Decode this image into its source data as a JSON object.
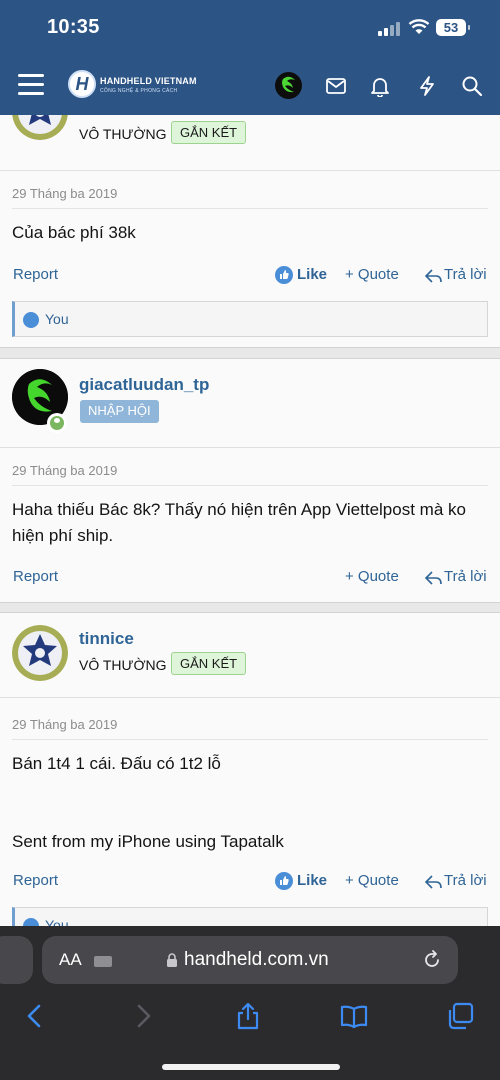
{
  "status": {
    "time": "10:35",
    "battery": "53"
  },
  "site": {
    "name": "HANDHELD VIETNAM",
    "tagline": "CÔNG NGHỆ & PHONG CÁCH",
    "mark": "H"
  },
  "posts": [
    {
      "rank": "VÔ THƯỜNG",
      "badge": "GẮN KẾT",
      "date": "29 Tháng ba 2019",
      "body": "Của bác phí 38k",
      "report": "Report",
      "like": "Like",
      "quote": "+ Quote",
      "reply": "Trả lời",
      "likes_by": "You"
    },
    {
      "username": "giacatluudan_tp",
      "badge": "NHẬP HỘI",
      "date": "29 Tháng ba 2019",
      "body": "Haha thiếu Bác 8k? Thấy nó hiện trên App Viettelpost mà ko hiện phí ship.",
      "report": "Report",
      "quote": "+ Quote",
      "reply": "Trả lời"
    },
    {
      "username": "tinnice",
      "rank": "VÔ THƯỜNG",
      "badge": "GẮN KẾT",
      "date": "29 Tháng ba 2019",
      "body_line1": "Bán 1t4 1 cái. Đấu có 1t2 lỗ",
      "body_line2": "Sent from my iPhone using Tapatalk",
      "report": "Report",
      "like": "Like",
      "quote": "+ Quote",
      "reply": "Trả lời",
      "likes_by": "You"
    }
  ],
  "browser": {
    "aa": "AA",
    "url": "handheld.com.vn"
  },
  "colors": {
    "header": "#2c5485",
    "link": "#2f6496",
    "badge_green": "#dff5d9",
    "badge_blue": "#8fb5d8"
  },
  "icons": [
    "hamburger-icon",
    "mail-icon",
    "bell-icon",
    "lightning-icon",
    "search-icon",
    "thumbs-up-icon",
    "reply-arrow-icon",
    "lock-icon",
    "reload-icon",
    "back-icon",
    "forward-icon",
    "share-icon",
    "bookmarks-icon",
    "tabs-icon"
  ]
}
